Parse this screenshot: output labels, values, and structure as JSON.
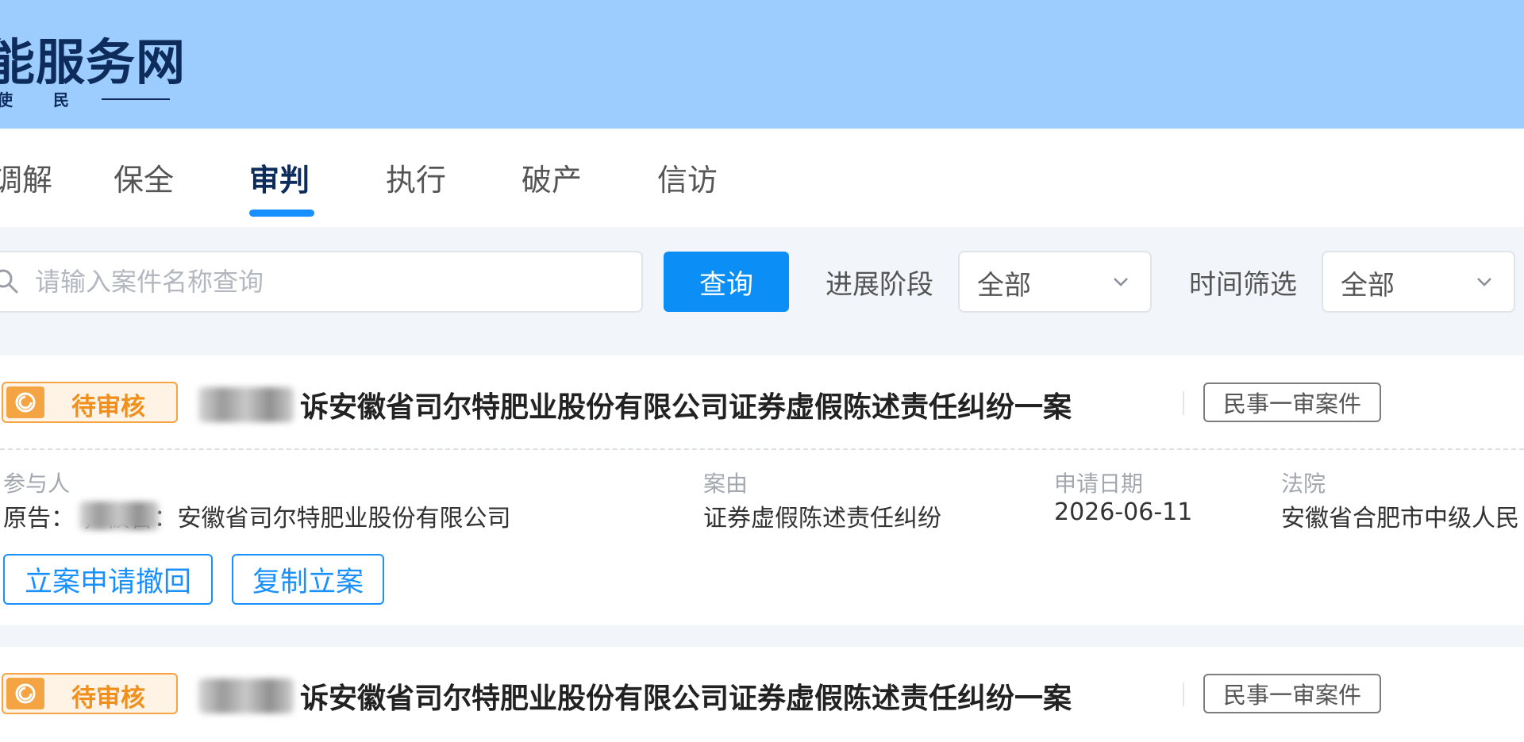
{
  "header": {
    "title": "能服务网",
    "subtitle": "使 民"
  },
  "tabs": [
    {
      "label": "调解",
      "active": false
    },
    {
      "label": "保全",
      "active": false
    },
    {
      "label": "审判",
      "active": true
    },
    {
      "label": "执行",
      "active": false
    },
    {
      "label": "破产",
      "active": false
    },
    {
      "label": "信访",
      "active": false
    }
  ],
  "filters": {
    "search_placeholder": "请输入案件名称查询",
    "search_value": "",
    "query_label": "查询",
    "stage_label": "进展阶段",
    "stage_value": "全部",
    "time_label": "时间筛选",
    "time_value": "全部"
  },
  "cases": [
    {
      "status": "待审核",
      "title": "诉安徽省司尔特肥业股份有限公司证券虚假陈述责任纠纷一案",
      "type": "民事一审案件",
      "participants_label": "参与人",
      "participants_value": "原告：       ，被告：安徽省司尔特肥业股份有限公司",
      "cause_label": "案由",
      "cause_value": "证券虚假陈述责任纠纷",
      "date_label": "申请日期",
      "date_value": "2026-06-11",
      "court_label": "法院",
      "court_value": "安徽省合肥市中级人民",
      "actions": [
        "立案申请撤回",
        "复制立案"
      ]
    },
    {
      "status": "待审核",
      "title": "诉安徽省司尔特肥业股份有限公司证券虚假陈述责任纠纷一案",
      "type": "民事一审案件"
    }
  ],
  "colors": {
    "header_bg": "#9ccdfe",
    "primary": "#1890ff",
    "pending": "#f5a443",
    "page_bg": "#f2f5fa"
  }
}
